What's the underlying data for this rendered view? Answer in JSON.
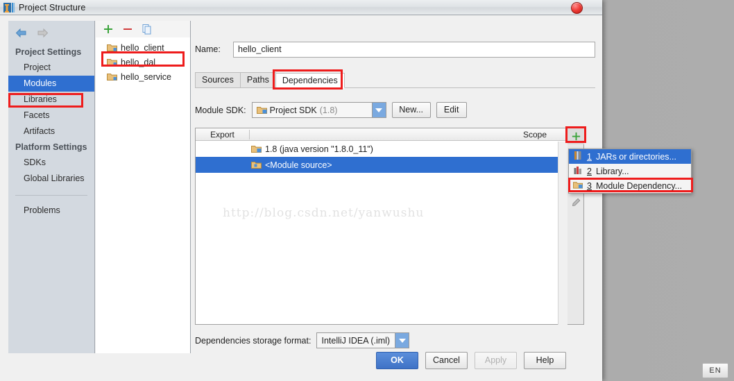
{
  "window": {
    "title": "Project Structure",
    "icon": "intellij-idea-icon",
    "close_label": "",
    "close_color": "#ef3b36"
  },
  "nav": {
    "back_icon": "arrow-left-icon",
    "forward_icon": "arrow-right-icon"
  },
  "sidebar": {
    "groups": [
      {
        "label": "Project Settings",
        "items": [
          {
            "label": "Project",
            "selected": false
          },
          {
            "label": "Modules",
            "selected": true,
            "highlight": "#2f6fd0",
            "annotated": true
          },
          {
            "label": "Libraries",
            "selected": false
          },
          {
            "label": "Facets",
            "selected": false
          },
          {
            "label": "Artifacts",
            "selected": false
          }
        ]
      },
      {
        "label": "Platform Settings",
        "items": [
          {
            "label": "SDKs",
            "selected": false
          },
          {
            "label": "Global Libraries",
            "selected": false
          }
        ]
      }
    ],
    "problems_label": "Problems"
  },
  "modules_panel": {
    "toolbar": [
      {
        "name": "add-module-button",
        "glyph": "+",
        "color": "#3aa33a"
      },
      {
        "name": "remove-module-button",
        "glyph": "−",
        "color": "#d03b3b"
      },
      {
        "name": "copy-module-button",
        "glyph": "copy-icon",
        "color": "#5b8fdb"
      }
    ],
    "modules": [
      {
        "label": "hello_client",
        "selected": true,
        "annotated": true
      },
      {
        "label": "hello_dal",
        "selected": false
      },
      {
        "label": "hello_service",
        "selected": false
      }
    ]
  },
  "main": {
    "name_label": "Name:",
    "name_value": "hello_client",
    "name_placeholder": "",
    "tabs": [
      {
        "label": "Sources",
        "active": false
      },
      {
        "label": "Paths",
        "active": false
      },
      {
        "label": "Dependencies",
        "active": true,
        "annotated": true
      }
    ],
    "sdk_label": "Module SDK:",
    "sdk_value": "Project SDK",
    "sdk_value_detail": "(1.8)",
    "sdk_new_button": "New...",
    "sdk_edit_button": "Edit",
    "table": {
      "columns": [
        "Export",
        "",
        "Scope"
      ],
      "rows": [
        {
          "icon": "jdk-folder-icon",
          "label": "1.8 (java version \"1.8.0_11\")",
          "dim_from": 3,
          "selected": false
        },
        {
          "icon": "module-source-folder-icon",
          "label": "<Module source>",
          "selected": true
        }
      ],
      "side_buttons": [
        {
          "name": "add-dependency-button",
          "glyph": "+",
          "color": "#3aa33a",
          "annotated": true
        },
        {
          "name": "edit-dependency-button",
          "glyph": "pencil-icon",
          "color": "#8a8a8a"
        }
      ]
    },
    "popup_menu": [
      {
        "num": "1",
        "label": "JARs or directories...",
        "icon": "jars-icon",
        "highlighted": true
      },
      {
        "num": "2",
        "label": "Library...",
        "icon": "library-icon",
        "highlighted": false
      },
      {
        "num": "3",
        "label": "Module Dependency...",
        "icon": "module-folder-icon",
        "highlighted": false,
        "annotated": true
      }
    ],
    "storage_label": "Dependencies storage format:",
    "storage_value": "IntelliJ IDEA (.iml)",
    "watermark": "http://blog.csdn.net/yanwushu"
  },
  "footer": {
    "buttons": [
      {
        "label": "OK",
        "style": "primary"
      },
      {
        "label": "Cancel",
        "style": "normal"
      },
      {
        "label": "Apply",
        "style": "disabled"
      },
      {
        "label": "Help",
        "style": "normal"
      }
    ]
  },
  "taskbar": {
    "language": "EN"
  },
  "colors": {
    "accent": "#2f6fd0",
    "annotation": "#ee1c1c",
    "sidebar_bg": "#d3d9e0"
  }
}
